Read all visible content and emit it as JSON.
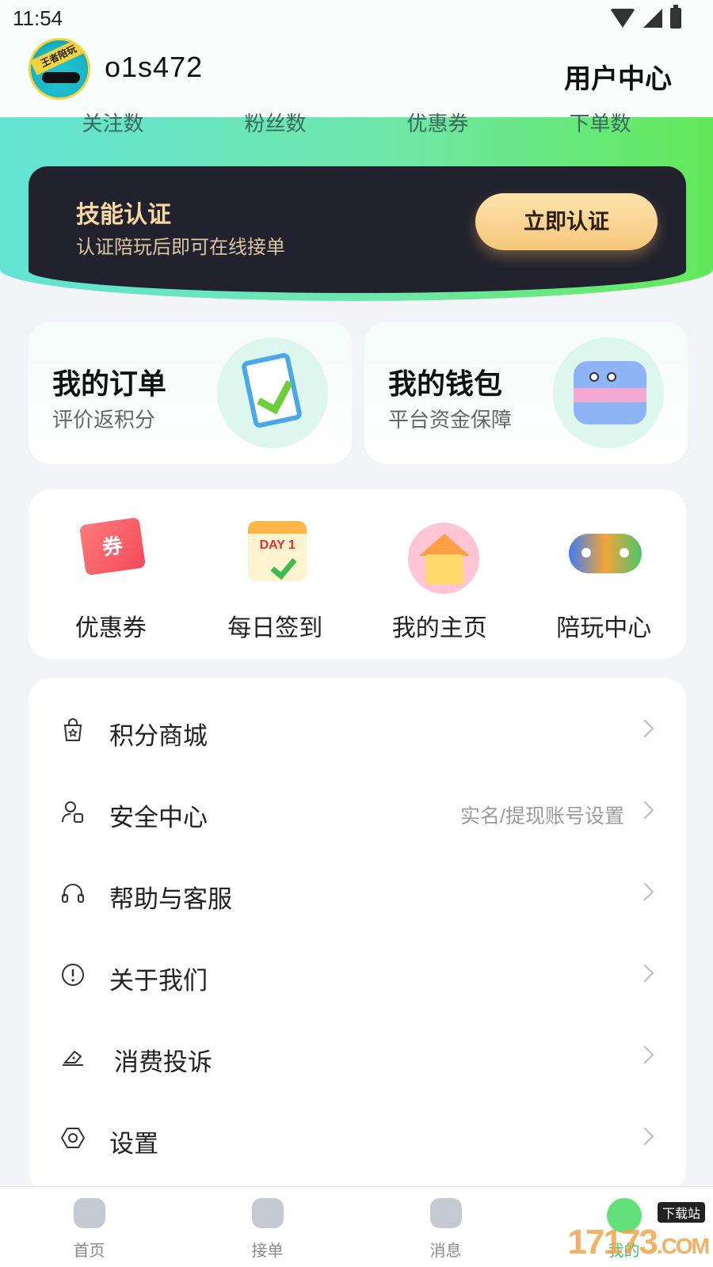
{
  "status_bar": {
    "time": "11:54"
  },
  "header": {
    "username": "o1s472",
    "title": "用户中心",
    "avatar_badge": "王者陪玩"
  },
  "stats": [
    "关注数",
    "粉丝数",
    "优惠券",
    "下单数"
  ],
  "skill_card": {
    "title": "技能认证",
    "subtitle": "认证陪玩后即可在线接单",
    "button": "立即认证"
  },
  "features": [
    {
      "title": "我的订单",
      "subtitle": "评价返积分"
    },
    {
      "title": "我的钱包",
      "subtitle": "平台资金保障"
    }
  ],
  "quick_actions": [
    {
      "label": "优惠券",
      "icon": "coupon-icon",
      "glyph": "券"
    },
    {
      "label": "每日签到",
      "icon": "calendar-checkin-icon",
      "glyph": "DAY 1"
    },
    {
      "label": "我的主页",
      "icon": "house-icon"
    },
    {
      "label": "陪玩中心",
      "icon": "gamepad-icon"
    }
  ],
  "menu": [
    {
      "label": "积分商城",
      "icon": "shopping-bag-icon",
      "hint": ""
    },
    {
      "label": "安全中心",
      "icon": "user-id-icon",
      "hint": "实名/提现账号设置"
    },
    {
      "label": "帮助与客服",
      "icon": "headset-icon",
      "hint": ""
    },
    {
      "label": "关于我们",
      "icon": "info-exclamation-icon",
      "hint": ""
    },
    {
      "label": "消费投诉",
      "icon": "complaint-icon",
      "hint": ""
    },
    {
      "label": "设置",
      "icon": "settings-hex-icon",
      "hint": ""
    }
  ],
  "tabbar": [
    {
      "label": "首页",
      "icon": "home-icon",
      "active": false
    },
    {
      "label": "接单",
      "icon": "cloud-heart-icon",
      "active": false
    },
    {
      "label": "消息",
      "icon": "message-icon",
      "active": false
    },
    {
      "label": "我的",
      "icon": "profile-face-icon",
      "active": true
    }
  ],
  "watermark": {
    "text": "17173",
    "domain": ".COM",
    "sub": "下载站"
  },
  "colors": {
    "hero_start": "#63e3d4",
    "hero_end": "#62e85a",
    "skill_bg": "#22222e",
    "skill_accent": "#f6d8a0",
    "button_gold": "#f6c77b",
    "active_tab": "#3fc36a"
  }
}
